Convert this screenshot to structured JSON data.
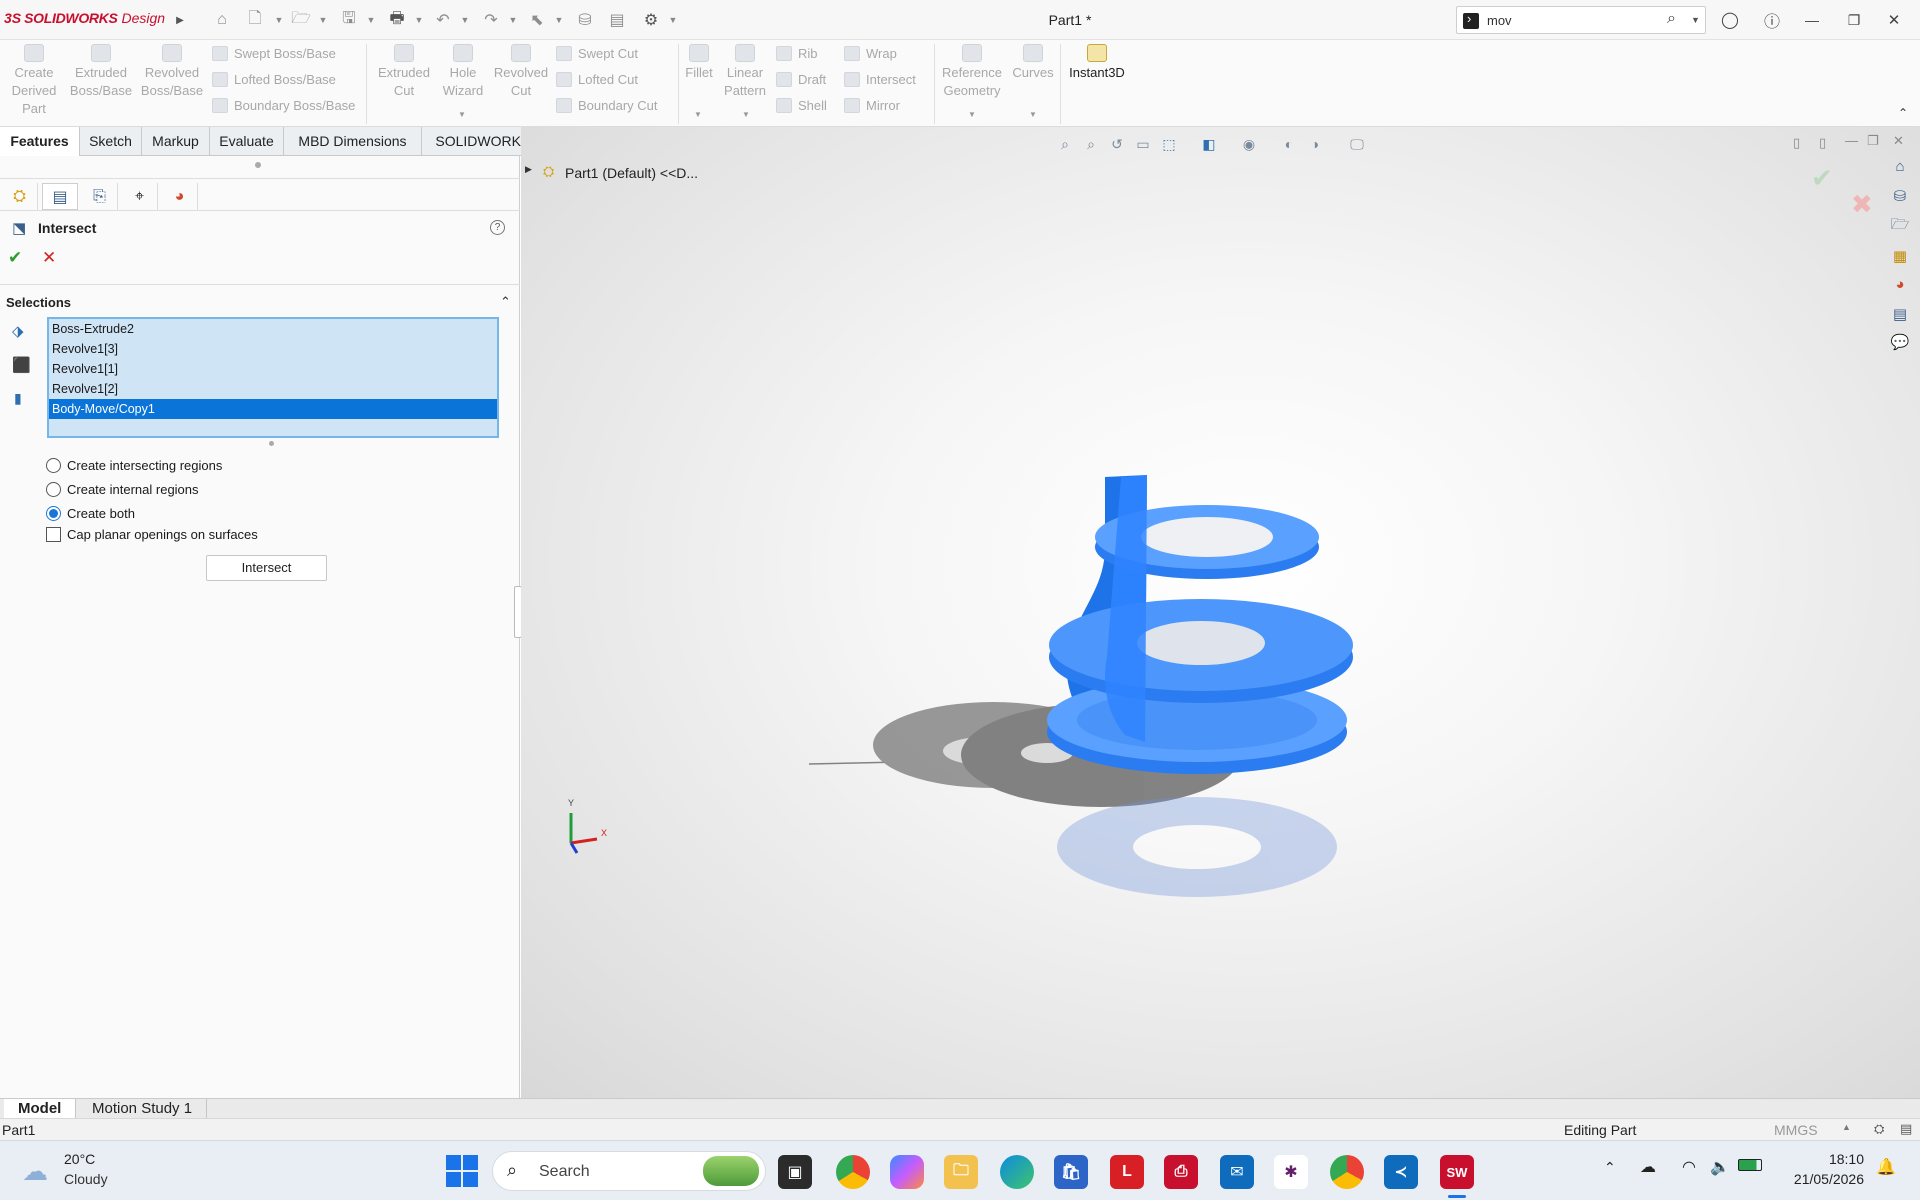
{
  "app": {
    "logo_ds": "3S",
    "logo_name": "SOLIDWORKS",
    "logo_suffix": "Design",
    "document_title": "Part1 *",
    "search_value": "mov"
  },
  "ribbon": {
    "create_derived_part": "Create Derived Part",
    "extruded_boss": "Extruded Boss/Base",
    "revolved_boss": "Revolved Boss/Base",
    "swept_boss": "Swept Boss/Base",
    "lofted_boss": "Lofted Boss/Base",
    "boundary_boss": "Boundary Boss/Base",
    "extruded_cut": "Extruded Cut",
    "hole_wizard": "Hole Wizard",
    "revolved_cut": "Revolved Cut",
    "swept_cut": "Swept Cut",
    "lofted_cut": "Lofted Cut",
    "boundary_cut": "Boundary Cut",
    "fillet": "Fillet",
    "linear_pattern": "Linear Pattern",
    "rib": "Rib",
    "draft": "Draft",
    "shell": "Shell",
    "wrap": "Wrap",
    "intersect": "Intersect",
    "mirror": "Mirror",
    "reference_geometry": "Reference Geometry",
    "curves": "Curves",
    "instant3d": "Instant3D"
  },
  "tabs": [
    "Features",
    "Sketch",
    "Markup",
    "Evaluate",
    "MBD Dimensions",
    "SOLIDWORKS Add-Ins"
  ],
  "panel": {
    "title": "Intersect",
    "section_selections": "Selections",
    "selections": [
      "Boss-Extrude2",
      "Revolve1[3]",
      "Revolve1[1]",
      "Revolve1[2]",
      "Body-Move/Copy1"
    ],
    "selected_index": 4,
    "options": {
      "intersecting": "Create intersecting regions",
      "internal": "Create internal regions",
      "both": "Create both",
      "cap": "Cap planar openings on surfaces"
    },
    "selected_option": "both",
    "intersect_button": "Intersect"
  },
  "viewport": {
    "tree_label": "Part1 (Default) <<D...",
    "axis_x": "X",
    "axis_y": "Y"
  },
  "bottom_tabs": [
    "Model",
    "Motion Study 1"
  ],
  "status": {
    "left": "Part1",
    "mode": "Editing Part",
    "units": "MMGS"
  },
  "taskbar": {
    "temperature": "20°C",
    "weather": "Cloudy",
    "search_label": "Search",
    "time": "18:10",
    "date": "21/05/2026"
  },
  "colors": {
    "accent": "#0a74d9",
    "brand_red": "#c8102e",
    "model_blue": "#2f7ff0"
  }
}
